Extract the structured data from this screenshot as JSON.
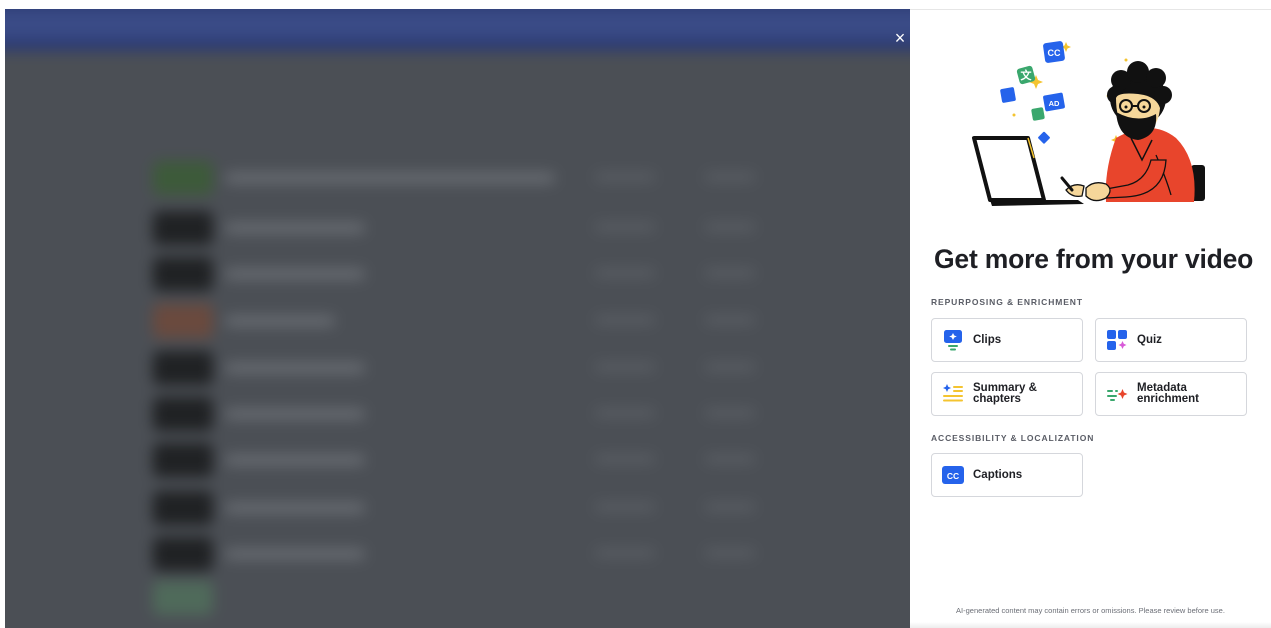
{
  "close_label": "×",
  "panel": {
    "title": "Get more from your video",
    "sections": [
      {
        "label": "REPURPOSING & ENRICHMENT",
        "items": [
          {
            "label": "Clips",
            "icon": "clips-icon"
          },
          {
            "label": "Quiz",
            "icon": "quiz-icon"
          },
          {
            "label": "Summary & chapters",
            "icon": "summary-icon"
          },
          {
            "label": "Metadata enrichment",
            "icon": "metadata-icon"
          }
        ]
      },
      {
        "label": "ACCESSIBILITY & LOCALIZATION",
        "items": [
          {
            "label": "Captions",
            "icon": "captions-icon",
            "badge": "CC"
          }
        ]
      }
    ],
    "disclaimer": "AI-generated content may contain errors or omissions. Please review before use."
  },
  "illustration": {
    "badges": [
      "CC",
      "AD"
    ]
  },
  "colors": {
    "accent_blue": "#2563eb",
    "accent_green": "#3aa76d",
    "accent_yellow": "#f4c430",
    "accent_red": "#e8452c",
    "accent_pink": "#d85bd8"
  }
}
